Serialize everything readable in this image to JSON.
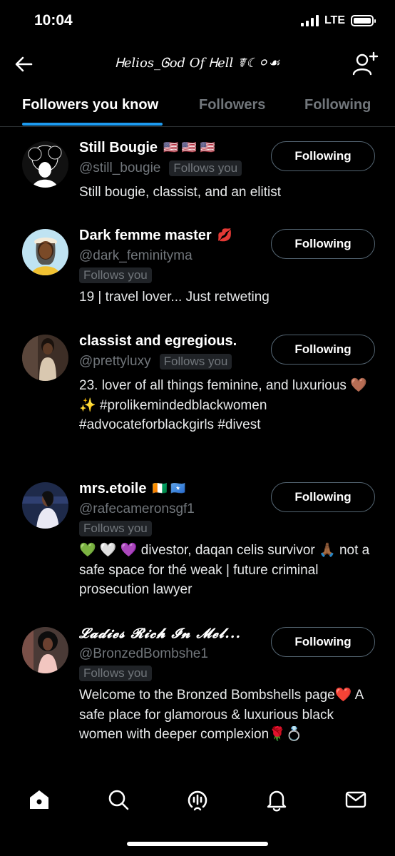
{
  "status_bar": {
    "time": "10:04",
    "network": "LTE",
    "signal_bars": 4,
    "battery_level": 1.0
  },
  "header": {
    "title": "Ꮋelios_Ꮆod Of Ꮋell ☤☾⚪︎☙",
    "back_icon": "arrow-left-icon",
    "add_user_icon": "person-add-icon"
  },
  "tabs": [
    {
      "label": "Followers you know",
      "active": true
    },
    {
      "label": "Followers",
      "active": false
    },
    {
      "label": "Following",
      "active": false
    }
  ],
  "accent_color": "#1d9bf0",
  "users": [
    {
      "name": "Still Bougie",
      "name_emoji": "🇺🇸 🇺🇸 🇺🇸",
      "handle": "@still_bougie",
      "follows_you": "Follows you",
      "bio": "Still bougie, classist, and an elitist",
      "button": "Following"
    },
    {
      "name": "Dark femme master",
      "name_emoji": "💋",
      "handle": "@dark_feminityma",
      "follows_you": "Follows you",
      "bio": "19 | travel lover... Just retweting",
      "button": "Following"
    },
    {
      "name": "classist and egregious.",
      "name_emoji": "",
      "handle": "@prettyluxy",
      "follows_you": "Follows you",
      "bio": "23. lover of all things feminine, and luxurious 🤎 ✨ #prolikemindedblackwomen #advocateforblackgirls #divest",
      "button": "Following"
    },
    {
      "name": "mrs.etoile",
      "name_emoji": "🇨🇮 🇸🇴",
      "handle": "@rafecameronsgf1",
      "follows_you": "Follows you",
      "bio": "💚 🤍 💜 divestor, daqan celis survivor 🙏🏾 not a safe space for thé weak | future criminal prosecution lawyer",
      "button": "Following"
    },
    {
      "name": "𝓛𝓪𝓭𝓲𝓮𝓼 𝓡𝓲𝓬𝓱 𝓘𝓷 𝓜𝓮𝓵...",
      "name_emoji": "",
      "handle": "@BronzedBombshe1",
      "follows_you": "Follows you",
      "bio": "Welcome to the Bronzed Bombshells page❤️ A safe place for glamorous & luxurious black women with deeper complexion🌹💍",
      "button": "Following"
    }
  ],
  "bottom_nav": [
    {
      "icon": "home-icon",
      "active": true
    },
    {
      "icon": "search-icon",
      "active": false
    },
    {
      "icon": "spaces-icon",
      "active": false
    },
    {
      "icon": "bell-icon",
      "active": false
    },
    {
      "icon": "mail-icon",
      "active": false
    }
  ]
}
